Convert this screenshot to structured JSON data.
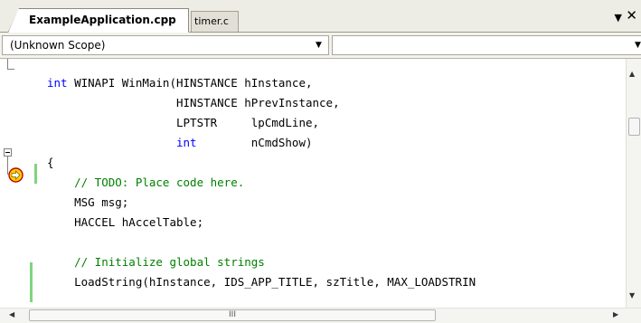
{
  "tabs": [
    {
      "label": "ExampleApplication.cpp",
      "active": true
    },
    {
      "label": "timer.c",
      "active": false
    }
  ],
  "tab_controls": {
    "menu_icon": "dropdown-arrow",
    "close_icon": "close-x"
  },
  "scope_bar": {
    "scope_value": "(Unknown Scope)",
    "member_value": ""
  },
  "code": {
    "lines": [
      {
        "segments": [
          {
            "t": "int",
            "c": "kw"
          },
          {
            "t": " WINAPI WinMain(HINSTANCE hInstance,",
            "c": ""
          }
        ]
      },
      {
        "segments": [
          {
            "t": "                   HINSTANCE hPrevInstance,",
            "c": ""
          }
        ]
      },
      {
        "segments": [
          {
            "t": "                   LPTSTR     lpCmdLine,",
            "c": ""
          }
        ]
      },
      {
        "segments": [
          {
            "t": "                   ",
            "c": ""
          },
          {
            "t": "int",
            "c": "kw"
          },
          {
            "t": "        nCmdShow)",
            "c": ""
          }
        ]
      },
      {
        "segments": [
          {
            "t": "{",
            "c": ""
          }
        ]
      },
      {
        "segments": [
          {
            "t": "    // TODO: Place code here.",
            "c": "cm"
          }
        ]
      },
      {
        "segments": [
          {
            "t": "    MSG msg;",
            "c": ""
          }
        ]
      },
      {
        "segments": [
          {
            "t": "    HACCEL hAccelTable;",
            "c": ""
          }
        ]
      },
      {
        "segments": [
          {
            "t": "",
            "c": ""
          }
        ]
      },
      {
        "segments": [
          {
            "t": "    // Initialize global strings",
            "c": "cm"
          }
        ]
      },
      {
        "segments": [
          {
            "t": "    LoadString(hInstance, IDS_APP_TITLE, szTitle, MAX_LOADSTRIN",
            "c": ""
          }
        ]
      }
    ]
  },
  "markers": {
    "current_statement_icon": "current-statement-arrow",
    "collapse_icon": "collapse-minus"
  },
  "colors": {
    "keyword": "#0000ff",
    "comment": "#008000",
    "changed_line_bar": "#7fd47f",
    "marker_fill": "#ffd400",
    "marker_border": "#c00000"
  },
  "scrollbars": {
    "horizontal_grip": "III"
  }
}
